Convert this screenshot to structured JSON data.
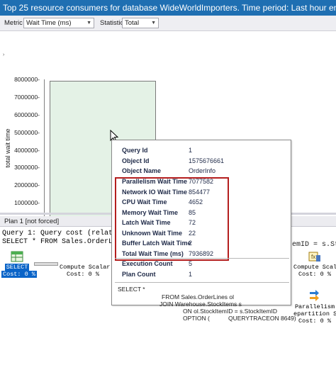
{
  "window": {
    "title": "Top 25 resource consumers for database WideWorldImporters. Time period: Last hour ending at 11/21/201"
  },
  "toolbar": {
    "metric_label": "Metric",
    "metric_value": "Wait Time (ms)",
    "statistic_label": "Statistic",
    "statistic_value": "Total"
  },
  "chart": {
    "y_axis_title": "total wait time",
    "y_ticks": [
      "8000000-",
      "7000000-",
      "6000000-",
      "5000000-",
      "4000000-",
      "3000000-",
      "2000000-",
      "1000000-"
    ]
  },
  "chart_data": {
    "type": "bar",
    "ylabel": "total wait time",
    "ylim": [
      0,
      8000000
    ],
    "values": [
      7936892
    ]
  },
  "plan": {
    "header": "Plan 1 [not forced]",
    "query_line_1": "Query 1: Query cost (relativ",
    "query_line_2": "SELECT * FROM Sales.OrderLin",
    "query_line_2_right": "emID = s.St",
    "operators": {
      "select_name": "SELECT",
      "select_cost": "Cost: 0 %",
      "compute_scalar_1_name": "Compute Scalar",
      "compute_scalar_1_cost": "Cost: 0 %",
      "compute_scalar_2_name": "Compute Scala",
      "compute_scalar_2_cost": "Cost: 0 %",
      "parallelism_name": "Parallelism",
      "parallelism_sub": "epartition Stre",
      "parallelism_cost": "Cost: 0 %"
    }
  },
  "tooltip": {
    "rows_top": [
      {
        "key": "Query Id",
        "value": "1"
      },
      {
        "key": "Object Id",
        "value": "1575676661"
      },
      {
        "key": "Object Name",
        "value": "OrderInfo"
      }
    ],
    "wait_rows": [
      {
        "key": "Parallelism Wait Time",
        "value": "7077582"
      },
      {
        "key": "Network IO Wait Time",
        "value": "854477"
      },
      {
        "key": "CPU Wait Time",
        "value": "4652"
      },
      {
        "key": "Memory Wait Time",
        "value": "85"
      },
      {
        "key": "Latch Wait Time",
        "value": "72"
      },
      {
        "key": "Unknown Wait Time",
        "value": "22"
      },
      {
        "key": "Buffer Latch Wait Time",
        "value": "2"
      },
      {
        "key": "Total Wait Time (ms)",
        "value": "7936892"
      }
    ],
    "rows_bottom": [
      {
        "key": "Execution Count",
        "value": "5"
      },
      {
        "key": "Plan Count",
        "value": "1"
      }
    ],
    "sql": {
      "line1": "SELECT *",
      "line2": "FROM Sales.OrderLines ol",
      "line3": "JOIN Warehouse.StockItems s",
      "line4": "ON ol.StockItemID = s.StockItemID",
      "line5": "OPTION (",
      "line5b": "QUERYTRACEON 8649)"
    },
    "highlight_color": "#b41e1e"
  }
}
